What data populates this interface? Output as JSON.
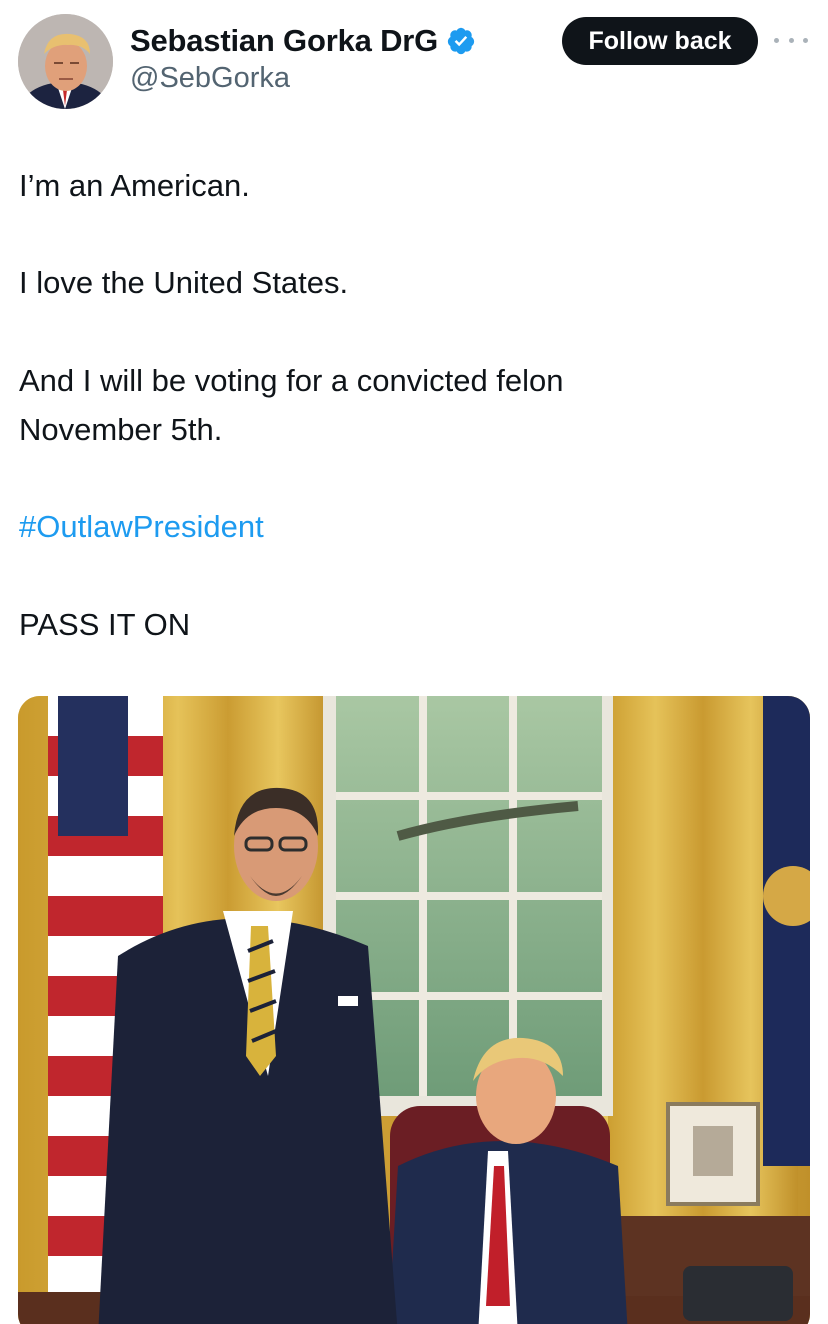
{
  "author": {
    "display_name": "Sebastian Gorka DrG",
    "handle": "@SebGorka",
    "verified": true,
    "avatar_icon": "profile-photo-avatar"
  },
  "actions": {
    "follow_label": "Follow back",
    "more_icon": "more-horizontal-icon"
  },
  "tweet": {
    "line1": "I’m an American.",
    "line2": "I love the United States.",
    "line3": "And I will be voting for a convicted felon",
    "line4": "November 5th.",
    "hashtag": "#OutlawPresident",
    "line5": "PASS IT ON"
  },
  "media": {
    "type": "photo",
    "description_icon": "attached-photo"
  },
  "colors": {
    "text": "#0f1419",
    "secondary": "#536471",
    "link": "#1d9bf0",
    "button_bg": "#0f1419",
    "verified": "#1d9bf0"
  }
}
